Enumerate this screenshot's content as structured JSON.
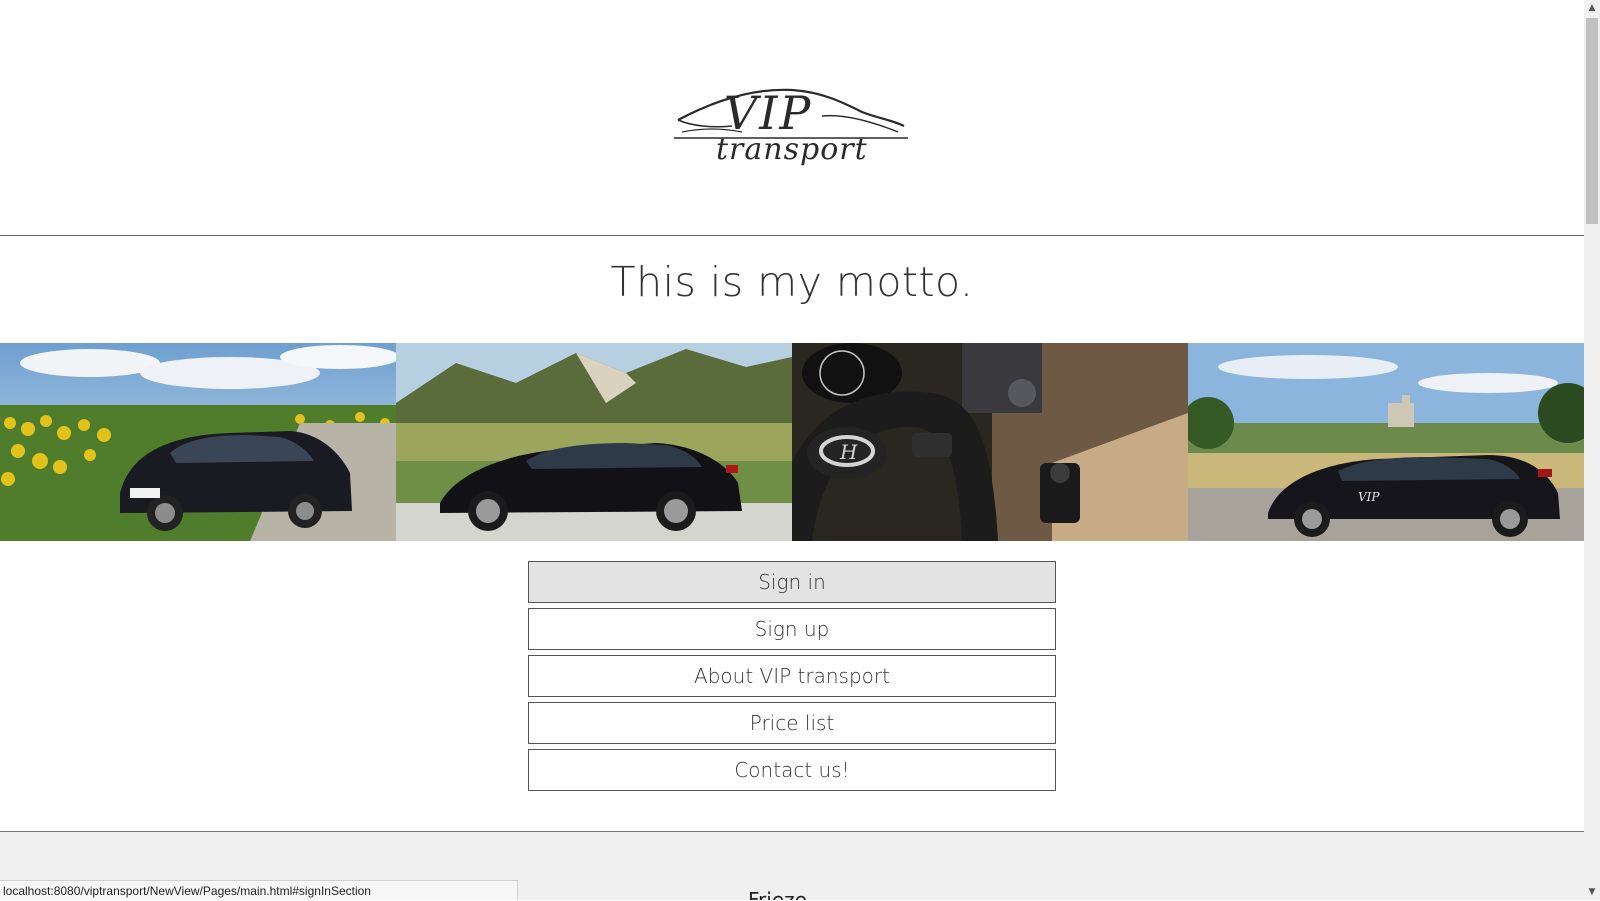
{
  "brand": {
    "logo_top": "VIP",
    "logo_bottom": "transport"
  },
  "motto": "This is my motto.",
  "gallery": {
    "photos": [
      {
        "icon": "car-sunflower-field-photo"
      },
      {
        "icon": "car-mountain-road-photo"
      },
      {
        "icon": "car-steering-wheel-interior-photo"
      },
      {
        "icon": "car-castle-landscape-photo"
      }
    ]
  },
  "menu": {
    "items": [
      {
        "label": "Sign in",
        "active": true
      },
      {
        "label": "Sign up",
        "active": false
      },
      {
        "label": "About VIP transport",
        "active": false
      },
      {
        "label": "Price list",
        "active": false
      },
      {
        "label": "Contact us!",
        "active": false
      }
    ]
  },
  "footer": {
    "peek_text": "Frieze to"
  },
  "status_bar": {
    "url": "localhost:8080/viptransport/NewView/Pages/main.html#signInSection"
  },
  "colors": {
    "active_button_bg": "#e3e3e3",
    "border": "#555555",
    "footer_bg": "#f0f0f0"
  }
}
